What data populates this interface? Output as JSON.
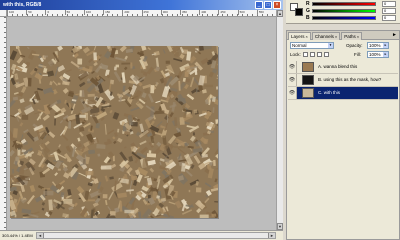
{
  "document": {
    "title": "with this, RGB/8",
    "window_buttons": {
      "minimize": "_",
      "maximize": "□",
      "close": "×"
    },
    "ruler_numbers": [
      "100",
      "50",
      "0",
      "50",
      "100",
      "150",
      "200",
      "250",
      "300",
      "350",
      "400",
      "450",
      "500",
      "550"
    ],
    "zoom_readout": "303.44% / 1.4EM",
    "image": "wood particle board texture",
    "scroll": {
      "up": "▲",
      "down": "▼",
      "left": "◄",
      "right": "►"
    }
  },
  "color_panel": {
    "foreground": "#ffffff",
    "background": "#000000",
    "sliders": [
      {
        "letter": "R",
        "value": "0",
        "color_from": "#000000",
        "color_to": "#ff0000"
      },
      {
        "letter": "G",
        "value": "0",
        "color_from": "#000000",
        "color_to": "#00ff00"
      },
      {
        "letter": "B",
        "value": "0",
        "color_from": "#000000",
        "color_to": "#0000ff"
      }
    ]
  },
  "layers_panel": {
    "tabs": [
      {
        "label": "Layers",
        "close": "×"
      },
      {
        "label": "Channels",
        "close": "×"
      },
      {
        "label": "Paths",
        "close": "×"
      }
    ],
    "menu_icon": "►",
    "blend_mode": "Normal",
    "opacity_label": "Opacity:",
    "opacity_value": "100%",
    "lock_label": "Lock:",
    "fill_label": "Fill:",
    "fill_value": "100%",
    "eye_glyph": "👁",
    "layers": [
      {
        "name": "A. wanna blend this",
        "thumb_color": "#9a7a52",
        "selected": false
      },
      {
        "name": "B. using this as the mask, how?",
        "thumb_color": "#141414",
        "selected": false
      },
      {
        "name": "C. with this",
        "thumb_color": "#c8b89a",
        "selected": true
      }
    ]
  },
  "colors": {
    "selection": "#0a2470",
    "title_bar": "#2a56c0",
    "panel": "#ece9d8",
    "canvas_bg": "#bdbdbd"
  }
}
